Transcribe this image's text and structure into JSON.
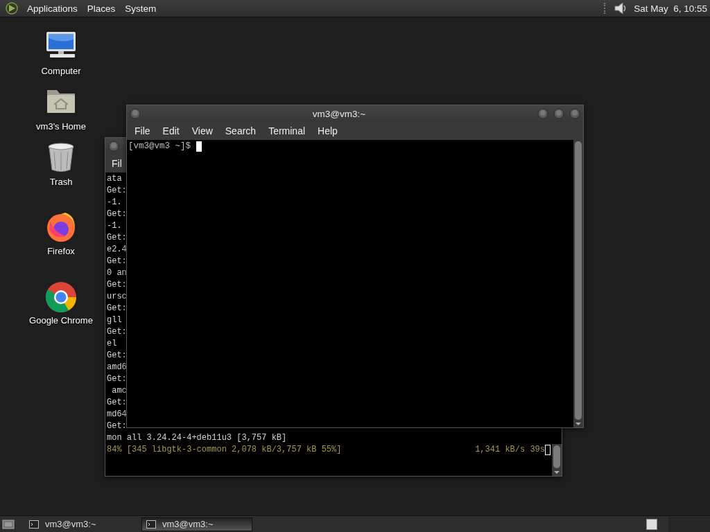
{
  "top_panel": {
    "menus": [
      "Applications",
      "Places",
      "System"
    ],
    "clock": "Sat May  6, 10:55"
  },
  "desktop_icons": [
    {
      "kind": "computer",
      "label": "Computer"
    },
    {
      "kind": "home",
      "label": "vm3's Home"
    },
    {
      "kind": "trash",
      "label": "Trash"
    },
    {
      "kind": "firefox",
      "label": "Firefox"
    },
    {
      "kind": "chrome",
      "label": "Google Chrome"
    }
  ],
  "windows": [
    {
      "focused": false,
      "menus": [
        "Fil"
      ],
      "lines": [
        "ata",
        "Get:",
        "-1.",
        "Get:",
        "-1.",
        "Get:",
        "e2.4",
        "Get:",
        "0 an",
        "Get:",
        "ursc",
        "Get:",
        "gll",
        "Get:",
        "el",
        "Get:",
        "amd6",
        "Get:",
        " amc",
        "Get:",
        "md64",
        "Get:",
        "mon all 3.24.24-4+deb11u3 [3,757 kB]"
      ],
      "status_line": {
        "text": "84% [345 libgtk-3-common 2,078 kB/3,757 kB 55%]",
        "rate": "1,341 kB/s 39s"
      }
    },
    {
      "focused": true,
      "title": "vm3@vm3:~",
      "menus": [
        "File",
        "Edit",
        "View",
        "Search",
        "Terminal",
        "Help"
      ],
      "lines": [
        "[vm3@vm3 ~]$ "
      ]
    }
  ],
  "taskbar": {
    "buttons": [
      {
        "label": "vm3@vm3:~",
        "selected": false
      },
      {
        "label": "vm3@vm3:~",
        "selected": true
      }
    ]
  }
}
